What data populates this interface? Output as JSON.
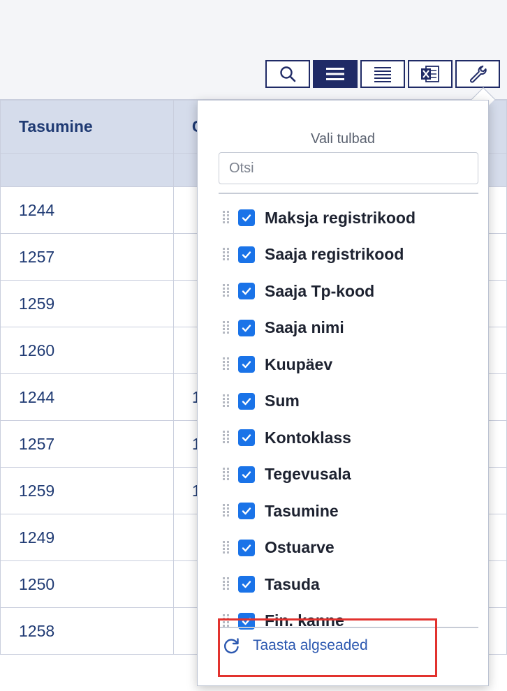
{
  "toolbar": {
    "buttons": [
      {
        "name": "search",
        "icon": "search-icon"
      },
      {
        "name": "list-view",
        "icon": "list-icon"
      },
      {
        "name": "compact-view",
        "icon": "compact-list-icon"
      },
      {
        "name": "excel-export",
        "icon": "excel-icon"
      },
      {
        "name": "settings",
        "icon": "wrench-icon"
      }
    ]
  },
  "table": {
    "headers": [
      "Tasumine",
      "C"
    ],
    "rows": [
      [
        "1244",
        ""
      ],
      [
        "1257",
        ""
      ],
      [
        "1259",
        ""
      ],
      [
        "1260",
        ""
      ],
      [
        "1244",
        "1"
      ],
      [
        "1257",
        "1"
      ],
      [
        "1259",
        "1"
      ],
      [
        "1249",
        ""
      ],
      [
        "1250",
        ""
      ],
      [
        "1258",
        ""
      ]
    ]
  },
  "panel": {
    "title": "Vali tulbad",
    "search_placeholder": "Otsi",
    "columns": [
      {
        "label": "Maksja registrikood",
        "checked": true
      },
      {
        "label": "Saaja registrikood",
        "checked": true
      },
      {
        "label": "Saaja Tp-kood",
        "checked": true
      },
      {
        "label": "Saaja nimi",
        "checked": true
      },
      {
        "label": "Kuupäev",
        "checked": true
      },
      {
        "label": "Sum",
        "checked": true
      },
      {
        "label": "Kontoklass",
        "checked": true
      },
      {
        "label": "Tegevusala",
        "checked": true
      },
      {
        "label": "Tasumine",
        "checked": true
      },
      {
        "label": "Ostuarve",
        "checked": true
      },
      {
        "label": "Tasuda",
        "checked": true
      },
      {
        "label": "Fin. kanne",
        "checked": true
      }
    ],
    "reset_label": "Taasta algseaded"
  },
  "colors": {
    "accent": "#1f2a66",
    "checkbox": "#1a73e8",
    "highlight": "#e2322e",
    "link": "#2c58b0"
  }
}
